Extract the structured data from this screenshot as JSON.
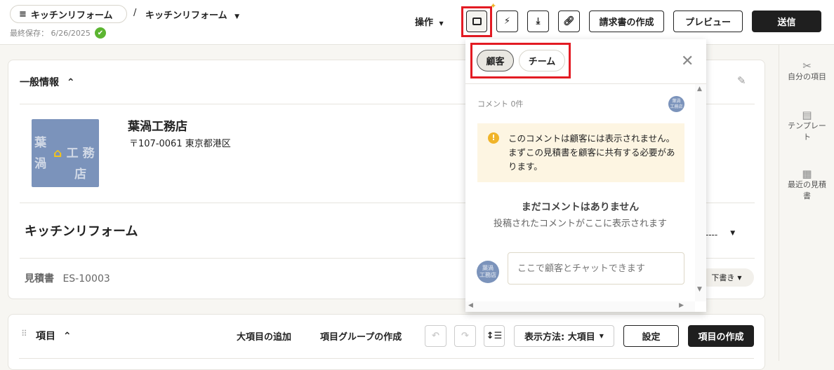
{
  "header": {
    "breadcrumb_root": "キッチンリフォーム",
    "separator": "/",
    "project_title": "キッチンリフォーム",
    "last_saved": "最終保存： 6/26/2025",
    "actions_label": "操作",
    "create_invoice": "請求書の作成",
    "preview": "プレビュー",
    "send": "送信"
  },
  "general": {
    "title": "一般情報",
    "company_name": "葉渦工務店",
    "address": "〒107-0061 東京都港区",
    "logo_text": "葉渦工務店",
    "project_name": "キッチンリフォーム",
    "date_placeholder": "/ ----",
    "doc_label": "見積書",
    "doc_number": "ES-10003",
    "status": "下書き"
  },
  "items": {
    "title": "項目",
    "add_major": "大項目の追加",
    "create_group": "項目グループの作成",
    "view_mode": "表示方法: 大項目",
    "settings": "設定",
    "create_item": "項目の作成"
  },
  "sidebar": {
    "items": [
      {
        "label": "自分の項目"
      },
      {
        "label": "テンプレート"
      },
      {
        "label": "最近の見積書"
      }
    ]
  },
  "comments": {
    "tabs": [
      "顧客",
      "チーム"
    ],
    "active_tab": "顧客",
    "count_label": "コメント 0件",
    "warning": "このコメントは顧客には表示されません。まずこの見積書を顧客に共有する必要があります。",
    "empty_title": "まだコメントはありません",
    "empty_sub": "投稿されたコメントがここに表示されます",
    "input_placeholder": "ここで顧客とチャットできます"
  },
  "colors": {
    "accent_red": "#e31b23",
    "success": "#5cb531",
    "warning_bg": "#fdf5e2",
    "warning_icon": "#f0b429",
    "logo_bg": "#7b93bb"
  }
}
